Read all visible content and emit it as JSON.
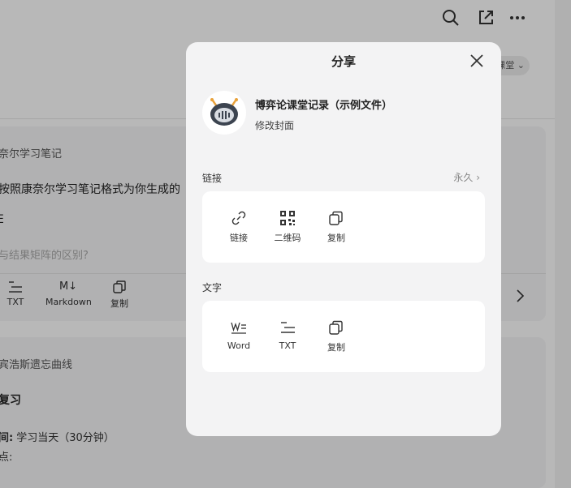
{
  "background": {
    "chip_label": "课堂",
    "card1": {
      "heading": "奈尔学习笔记",
      "line1": "按照康奈尔学习笔记格式为你生成的",
      "line2": "E",
      "question": "与结果矩阵的区别?"
    },
    "toolbar": [
      {
        "label": "TXT",
        "icon": "txt-icon"
      },
      {
        "label": "Markdown",
        "icon": "markdown-icon"
      },
      {
        "label": "复制",
        "icon": "copy-icon"
      }
    ],
    "card2": {
      "heading": "宾浩斯遗忘曲线",
      "subheading": "复习",
      "time_label": "间:",
      "time_value": "学习当天（30分钟）",
      "points_label": "点:"
    }
  },
  "modal": {
    "title": "分享",
    "doc_title": "博弈论课堂记录（示例文件）",
    "edit_cover": "修改封面",
    "link_section": {
      "label": "链接",
      "permission": "永久",
      "options": [
        {
          "label": "链接",
          "icon": "link-icon"
        },
        {
          "label": "二维码",
          "icon": "qrcode-icon"
        },
        {
          "label": "复制",
          "icon": "copy-icon"
        }
      ]
    },
    "text_section": {
      "label": "文字",
      "options": [
        {
          "label": "Word",
          "icon": "word-icon"
        },
        {
          "label": "TXT",
          "icon": "txt-icon"
        },
        {
          "label": "复制",
          "icon": "copy-icon"
        }
      ]
    }
  },
  "colors": {
    "overlay": "#000000",
    "modal_bg": "#f3f3f4",
    "panel_bg": "#ffffff"
  }
}
